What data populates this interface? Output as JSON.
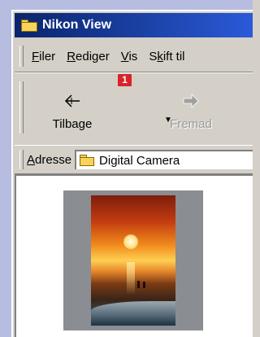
{
  "window": {
    "title": "Nikon View"
  },
  "menu": {
    "items": [
      {
        "label": "Filer",
        "mnemonic": "F"
      },
      {
        "label": "Rediger",
        "mnemonic": "R"
      },
      {
        "label": "Vis",
        "mnemonic": "V"
      },
      {
        "label": "Skift til",
        "mnemonic": "k"
      }
    ]
  },
  "toolbar": {
    "back_label": "Tilbage",
    "forward_label": "Fremad",
    "badge_number": "1"
  },
  "address": {
    "label": "Adresse",
    "value": "Digital Camera"
  },
  "icons": [
    "folder-icon",
    "back-arrow-icon",
    "forward-arrow-icon",
    "dropdown-arrow-icon",
    "address-folder-icon"
  ],
  "colors": {
    "titlebar_start": "#0a246a",
    "titlebar_end": "#2a5ad8",
    "badge": "#d8232a"
  }
}
